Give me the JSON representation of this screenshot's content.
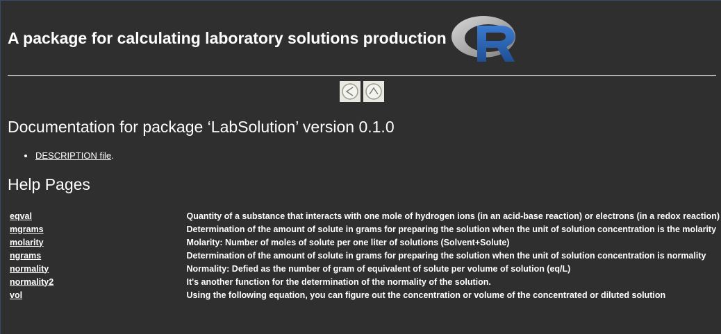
{
  "header": {
    "title": "A package for calculating laboratory solutions production",
    "logo_icon": "r-logo-icon"
  },
  "nav": {
    "back_icon": "arrow-left-icon",
    "up_icon": "arrow-up-icon"
  },
  "doc": {
    "title": "Documentation for package ‘LabSolution’ version 0.1.0",
    "description_link": "DESCRIPTION file",
    "description_suffix": "."
  },
  "help": {
    "title": "Help Pages",
    "rows": [
      {
        "name": "eqval",
        "desc": "Quantity of a substance that interacts with one mole of hydrogen ions (in an acid-base reaction) or electrons (in a redox reaction)"
      },
      {
        "name": "mgrams",
        "desc": "Determination of the amount of solute in grams for preparing the solution when the unit of solution concentration is the molarity"
      },
      {
        "name": "molarity",
        "desc": "Molarity: Number of moles of solute per one liter of solutions (Solvent+Solute)"
      },
      {
        "name": "ngrams",
        "desc": "Determination of the amount of solute in grams for preparing the solution when the unit of solution concentration is normality"
      },
      {
        "name": "normality",
        "desc": "Normality: Defied as the number of gram of equivalent of solute per volume of solution (eq/L)"
      },
      {
        "name": "normality2",
        "desc": "It's another function for the determination of the normality of the solution."
      },
      {
        "name": "vol",
        "desc": "Using the following equation, you can figure out the concentration or volume of the concentrated or diluted solution"
      }
    ]
  },
  "colors": {
    "background": "#2f2f2f",
    "text": "#ffffff",
    "logo_ring": "#a8a8a8",
    "logo_letter": "#2d66b2"
  }
}
